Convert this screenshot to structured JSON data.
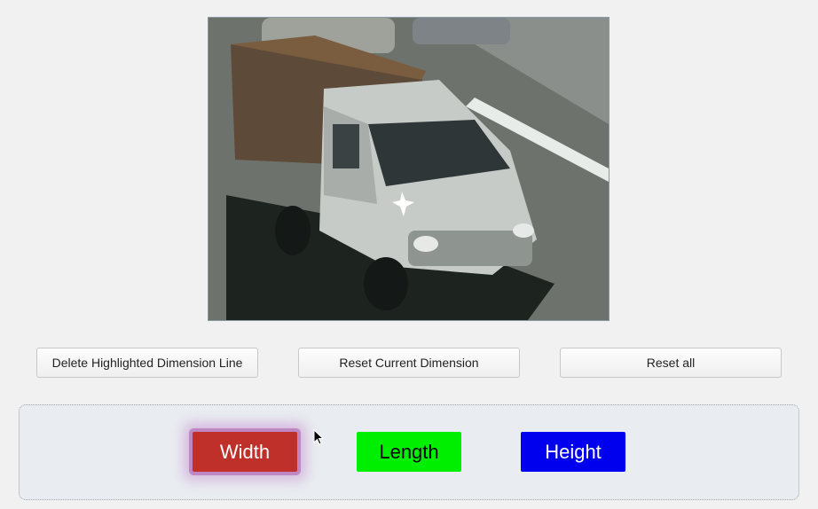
{
  "image": {
    "alt": "",
    "icon": "truck-photo"
  },
  "actions": {
    "delete_label": "Delete Highlighted Dimension Line",
    "reset_current_label": "Reset Current Dimension",
    "reset_all_label": "Reset all"
  },
  "dimensions": {
    "width_label": "Width",
    "length_label": "Length",
    "height_label": "Height",
    "colors": {
      "width": "#c0302a",
      "length": "#00ee00",
      "height": "#0000ee"
    },
    "selected": "Width"
  }
}
